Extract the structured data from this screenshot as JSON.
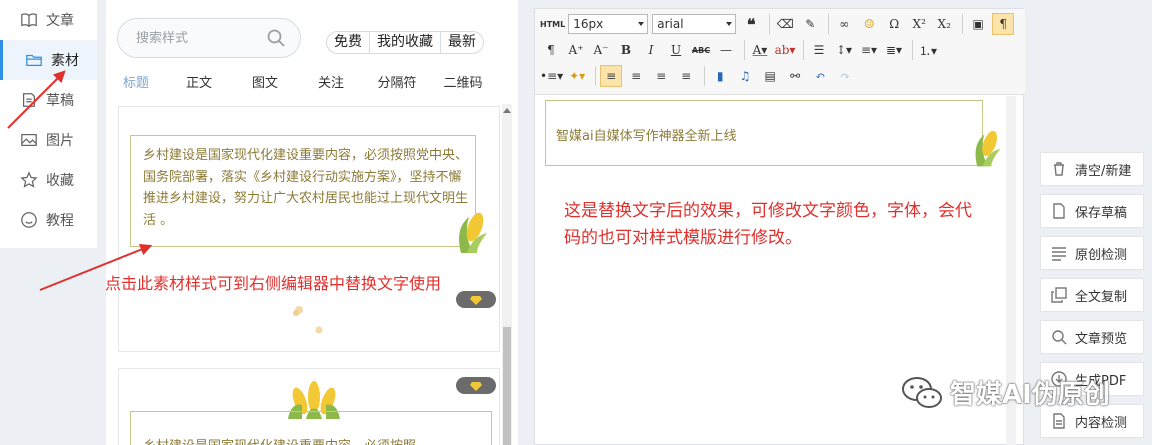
{
  "nav": [
    {
      "label": "文章",
      "icon": "book-icon"
    },
    {
      "label": "素材",
      "icon": "folder-icon",
      "active": true
    },
    {
      "label": "草稿",
      "icon": "draft-icon"
    },
    {
      "label": "图片",
      "icon": "image-icon"
    },
    {
      "label": "收藏",
      "icon": "star-icon"
    },
    {
      "label": "教程",
      "icon": "smile-icon"
    }
  ],
  "materials": {
    "search_placeholder": "搜索样式",
    "filters": [
      "免费",
      "我的收藏",
      "最新"
    ],
    "tabs": [
      "标题",
      "正文",
      "图文",
      "关注",
      "分隔符",
      "二维码"
    ],
    "active_tab": "标题",
    "card1_text": "乡村建设是国家现代化建设重要内容，必须按照党中央、国务院部署，落实《乡村建设行动实施方案》，坚持不懈推进乡村建设，努力让广大农村居民也能过上现代文明生活 。",
    "card2_text": "乡村建设是国家现代化建设重要内容，必须按照"
  },
  "annotations": {
    "left": "点击此素材样式可到右侧编辑器中替换文字使用",
    "right": "这是替换文字后的效果，可修改文字颜色，字体，会代码的也可对样式模版进行修改。"
  },
  "editor": {
    "font_size": "16px",
    "font_family": "arial",
    "html_label": "HTML",
    "content_text": "智媒ai自媒体写作神器全新上线"
  },
  "actions": [
    {
      "label": "清空/新建",
      "icon": "trash-icon"
    },
    {
      "label": "保存草稿",
      "icon": "file-icon"
    },
    {
      "label": "原创检测",
      "icon": "lines-icon"
    },
    {
      "label": "全文复制",
      "icon": "copy-icon"
    },
    {
      "label": "文章预览",
      "icon": "search-icon"
    },
    {
      "label": "生成PDF",
      "icon": "download-icon"
    },
    {
      "label": "内容检测",
      "icon": "doc-icon"
    }
  ],
  "watermark": "智媒AI伪原创",
  "colors": {
    "accent": "#2f8fe6",
    "olive": "#8c7b37",
    "annotation": "#e0302d"
  }
}
